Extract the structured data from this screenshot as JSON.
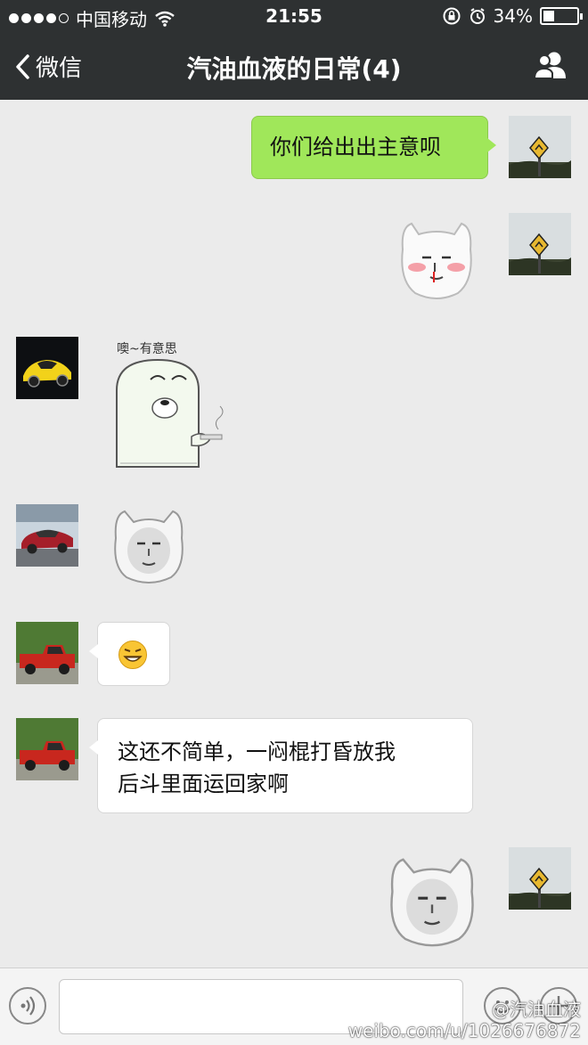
{
  "status_bar": {
    "carrier": "中国移动",
    "time": "21:55",
    "battery": "34%",
    "battery_level": 0.34
  },
  "nav": {
    "back_label": "微信",
    "title": "汽油血液的日常(4)"
  },
  "messages": [
    {
      "side": "right",
      "type": "text",
      "text": "你们给出出主意呗"
    },
    {
      "side": "right",
      "type": "sticker"
    },
    {
      "side": "left",
      "type": "sticker",
      "caption": "噢~有意思"
    },
    {
      "side": "left",
      "type": "sticker"
    },
    {
      "side": "left",
      "type": "emoji"
    },
    {
      "side": "left",
      "type": "text",
      "line1": "这还不简单，一闷棍打昏放我",
      "line2": "后斗里面运回家啊"
    },
    {
      "side": "right",
      "type": "sticker"
    }
  ],
  "watermark": {
    "line1": "@汽油血液",
    "line2": "weibo.com/u/1026676872"
  },
  "colors": {
    "header": "#2e3132",
    "chat_bg": "#ebebeb",
    "my_bubble": "#a0e75a",
    "other_bubble": "#ffffff"
  }
}
